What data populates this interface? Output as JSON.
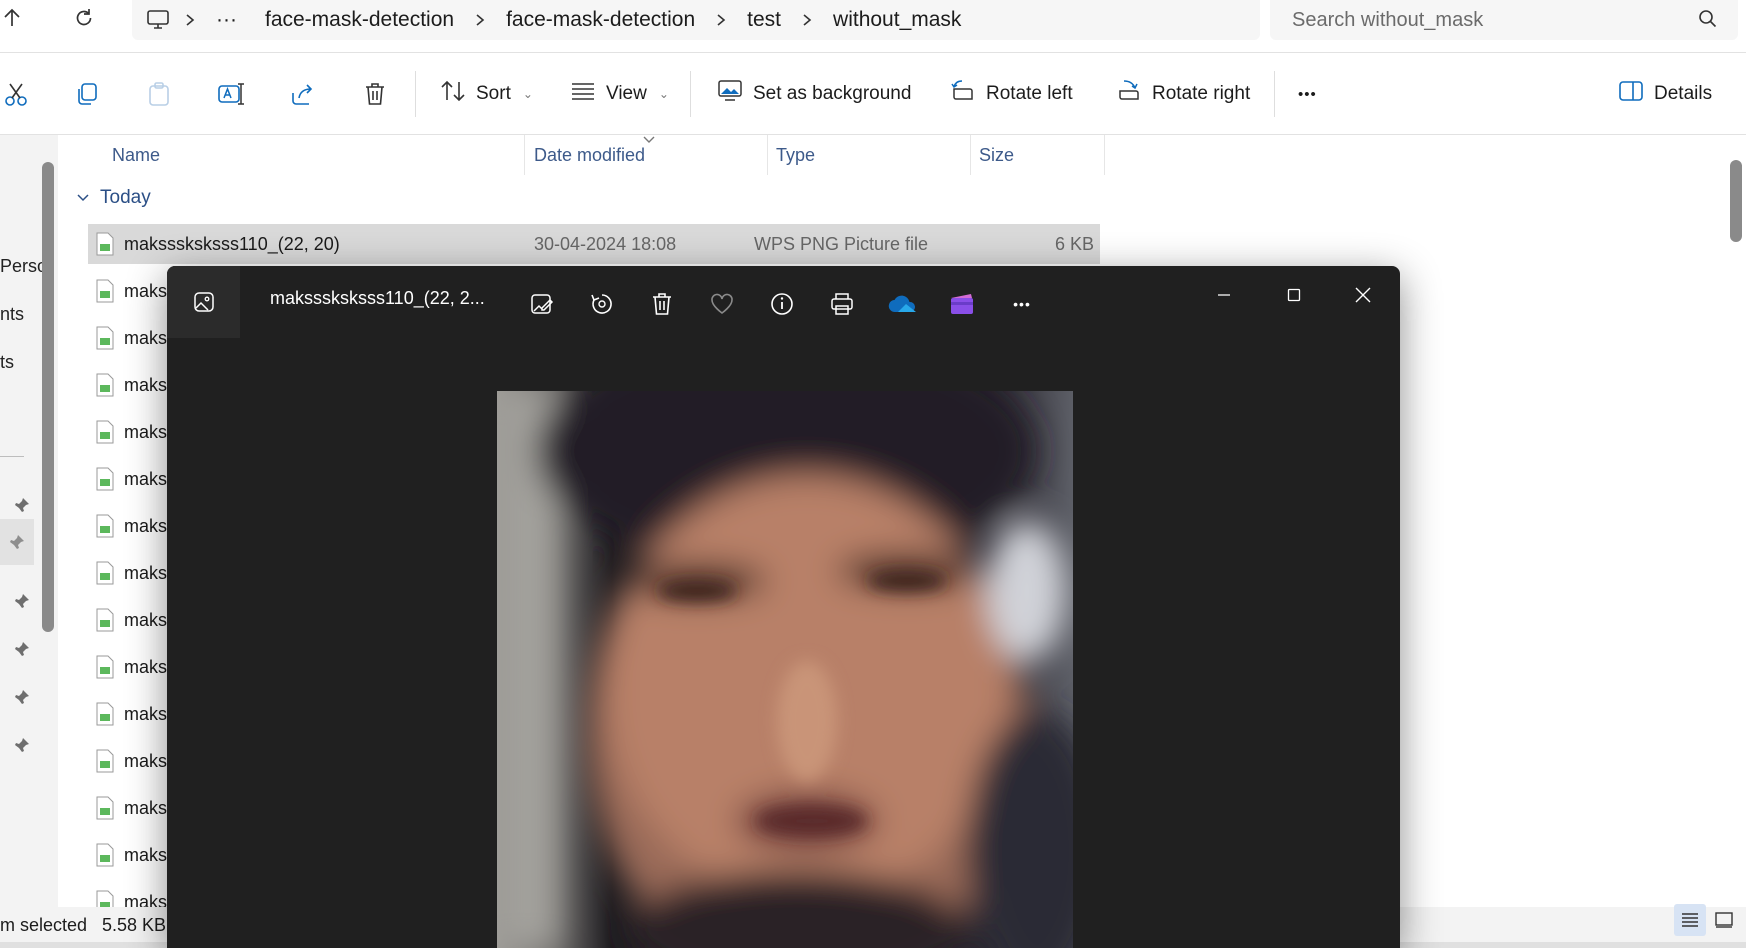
{
  "addressbar": {
    "breadcrumbs": [
      "···",
      "face-mask-detection",
      "face-mask-detection",
      "test",
      "without_mask"
    ],
    "search_placeholder": "Search without_mask"
  },
  "commandbar": {
    "sort_label": "Sort",
    "view_label": "View",
    "set_background_label": "Set as background",
    "rotate_left_label": "Rotate left",
    "rotate_right_label": "Rotate right",
    "more_label": "•••",
    "details_label": "Details"
  },
  "leftnav": {
    "items": [
      "Perso",
      "nts",
      "ts"
    ]
  },
  "filelist": {
    "columns": {
      "name": "Name",
      "date": "Date modified",
      "type": "Type",
      "size": "Size"
    },
    "group": "Today",
    "selected_file": {
      "name": "maksssksksss110_(22, 20)",
      "date": "30-04-2024 18:08",
      "type": "WPS PNG Picture file",
      "size": "6 KB"
    },
    "other_rows": [
      "maks",
      "maks",
      "maks",
      "maks",
      "maks",
      "maks",
      "maks",
      "maks",
      "maks",
      "maks",
      "maks",
      "maks",
      "maks",
      "maks"
    ]
  },
  "statusbar": {
    "selection_text": "m selected",
    "selection_size": "5.58 KB"
  },
  "viewer": {
    "title": "maksssksksss110_(22, 2...",
    "more_label": "•••",
    "accent_onedrive": "#0f6cbd",
    "accent_clipchamp": "#8a4fe8"
  }
}
